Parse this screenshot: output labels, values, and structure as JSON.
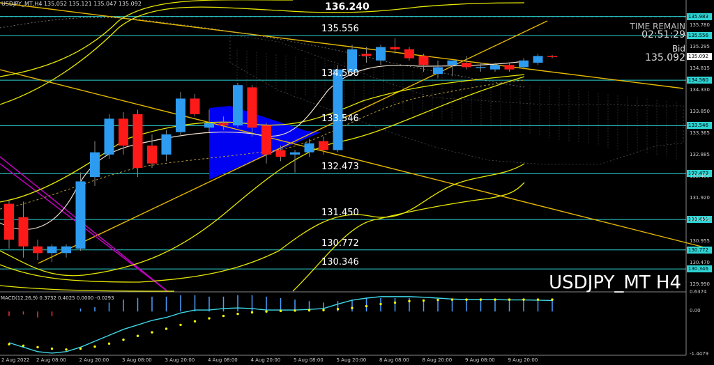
{
  "window": {
    "symbol_line": "USDJPY_MT,H4  135.052 135.121 135.047 135.092",
    "watermark": "USDJPY_MT H4"
  },
  "info": {
    "time_remain_label": "TIME REMAIN",
    "time_remain_value": "02:51:29",
    "bid_label": "Bid",
    "bid_value": "135.092"
  },
  "top_label": "136.240",
  "levels": [
    {
      "label": "135.983",
      "price": 135.983,
      "show_chart_label": false
    },
    {
      "label": "135.556",
      "price": 135.556,
      "show_chart_label": true
    },
    {
      "label": "134.560",
      "price": 134.56,
      "show_chart_label": true
    },
    {
      "label": "133.546",
      "price": 133.546,
      "show_chart_label": true
    },
    {
      "label": "132.473",
      "price": 132.473,
      "show_chart_label": true
    },
    {
      "label": "131.450",
      "price": 131.45,
      "show_chart_label": true
    },
    {
      "label": "130.772",
      "price": 130.772,
      "show_chart_label": true
    },
    {
      "label": "130.346",
      "price": 130.346,
      "show_chart_label": true
    }
  ],
  "price_axis": [
    "135.780",
    "135.295",
    "134.815",
    "134.330",
    "133.850",
    "133.365",
    "132.885",
    "132.400",
    "131.920",
    "131.435",
    "130.955",
    "130.470",
    "129.990"
  ],
  "current_price": "135.092",
  "time_axis": [
    "2 Aug 2022",
    "2 Aug 08:00",
    "2 Aug 20:00",
    "3 Aug 08:00",
    "3 Aug 20:00",
    "4 Aug 08:00",
    "4 Aug 20:00",
    "5 Aug 08:00",
    "5 Aug 20:00",
    "8 Aug 08:00",
    "8 Aug 20:00",
    "9 Aug 08:00",
    "9 Aug 20:00"
  ],
  "macd": {
    "label": "MACD(12,26,9) 0.3732 0.4025 0.0000 -0.0293",
    "axis": [
      "0.6374",
      "0.00",
      "-1.4479"
    ]
  },
  "colors": {
    "bull": "#2d9bf0",
    "bear": "#ff1a1a",
    "level_line": "#2ed3d3",
    "trendline": "#e6b800",
    "bands": "#e6e600",
    "macd_main": "#3fd7e8",
    "macd_signal": "#ffff00",
    "triangle": "#0000ff"
  },
  "chart_data": {
    "type": "candlestick",
    "ylim": [
      129.85,
      136.35
    ],
    "candles": [
      {
        "o": 131.8,
        "h": 131.9,
        "l": 130.8,
        "c": 131.0
      },
      {
        "o": 131.5,
        "h": 131.85,
        "l": 130.6,
        "c": 130.85
      },
      {
        "o": 130.85,
        "h": 131.0,
        "l": 130.55,
        "c": 130.7
      },
      {
        "o": 130.7,
        "h": 130.9,
        "l": 130.5,
        "c": 130.85
      },
      {
        "o": 130.7,
        "h": 130.9,
        "l": 130.6,
        "c": 130.85
      },
      {
        "o": 130.8,
        "h": 132.5,
        "l": 130.75,
        "c": 132.3
      },
      {
        "o": 132.4,
        "h": 133.2,
        "l": 132.2,
        "c": 132.95
      },
      {
        "o": 132.9,
        "h": 133.8,
        "l": 132.8,
        "c": 133.7
      },
      {
        "o": 133.7,
        "h": 133.85,
        "l": 132.9,
        "c": 133.1
      },
      {
        "o": 133.8,
        "h": 133.9,
        "l": 132.4,
        "c": 132.6
      },
      {
        "o": 133.1,
        "h": 133.35,
        "l": 132.6,
        "c": 132.7
      },
      {
        "o": 132.9,
        "h": 133.45,
        "l": 132.75,
        "c": 133.35
      },
      {
        "o": 133.4,
        "h": 134.3,
        "l": 133.3,
        "c": 134.15
      },
      {
        "o": 134.15,
        "h": 134.25,
        "l": 133.75,
        "c": 133.8
      },
      {
        "o": 133.5,
        "h": 133.9,
        "l": 133.4,
        "c": 133.6
      },
      {
        "o": 133.6,
        "h": 133.75,
        "l": 133.45,
        "c": 133.55
      },
      {
        "o": 133.55,
        "h": 134.5,
        "l": 133.5,
        "c": 134.45
      },
      {
        "o": 134.4,
        "h": 134.45,
        "l": 133.3,
        "c": 133.5
      },
      {
        "o": 133.55,
        "h": 133.6,
        "l": 132.7,
        "c": 132.9
      },
      {
        "o": 133.0,
        "h": 133.1,
        "l": 132.75,
        "c": 132.85
      },
      {
        "o": 132.9,
        "h": 133.0,
        "l": 132.5,
        "c": 132.95
      },
      {
        "o": 132.95,
        "h": 133.25,
        "l": 132.85,
        "c": 133.15
      },
      {
        "o": 133.2,
        "h": 133.3,
        "l": 132.9,
        "c": 133.0
      },
      {
        "o": 133.0,
        "h": 134.9,
        "l": 132.95,
        "c": 134.8
      },
      {
        "o": 134.75,
        "h": 135.35,
        "l": 134.7,
        "c": 135.25
      },
      {
        "o": 135.15,
        "h": 135.3,
        "l": 134.95,
        "c": 135.1
      },
      {
        "o": 135.0,
        "h": 135.35,
        "l": 134.9,
        "c": 135.3
      },
      {
        "o": 135.3,
        "h": 135.5,
        "l": 135.15,
        "c": 135.25
      },
      {
        "o": 135.25,
        "h": 135.3,
        "l": 135.0,
        "c": 135.05
      },
      {
        "o": 135.1,
        "h": 135.15,
        "l": 134.75,
        "c": 134.9
      },
      {
        "o": 134.7,
        "h": 135.0,
        "l": 134.6,
        "c": 134.85
      },
      {
        "o": 134.9,
        "h": 135.0,
        "l": 134.65,
        "c": 135.0
      },
      {
        "o": 134.95,
        "h": 135.1,
        "l": 134.8,
        "c": 134.85
      },
      {
        "o": 134.85,
        "h": 134.95,
        "l": 134.75,
        "c": 134.85
      },
      {
        "o": 134.8,
        "h": 134.95,
        "l": 134.75,
        "c": 134.9
      },
      {
        "o": 134.9,
        "h": 134.95,
        "l": 134.75,
        "c": 134.8
      },
      {
        "o": 134.85,
        "h": 135.05,
        "l": 134.8,
        "c": 135.0
      },
      {
        "o": 134.95,
        "h": 135.15,
        "l": 134.9,
        "c": 135.1
      },
      {
        "o": 135.1,
        "h": 135.12,
        "l": 135.05,
        "c": 135.09
      }
    ],
    "macd_histogram": [
      -0.15,
      -0.1,
      -0.2,
      -0.15,
      0.0,
      0.1,
      0.15,
      0.3,
      0.4,
      0.45,
      0.5,
      0.5,
      0.55,
      0.55,
      0.5,
      0.5,
      0.55,
      0.55,
      0.5,
      0.45,
      0.4,
      0.35,
      0.3,
      0.35,
      0.4,
      0.45,
      0.45,
      0.45,
      0.45,
      0.4,
      0.4,
      0.4,
      0.38,
      0.37,
      0.37,
      0.37,
      0.37,
      0.37,
      0.37
    ],
    "macd_main": [
      -1.05,
      -1.2,
      -1.35,
      -1.4,
      -1.35,
      -1.2,
      -1.0,
      -0.8,
      -0.6,
      -0.45,
      -0.3,
      -0.2,
      -0.05,
      0.05,
      0.05,
      0.1,
      0.12,
      0.1,
      0.05,
      0.05,
      0.05,
      0.07,
      0.1,
      0.25,
      0.38,
      0.45,
      0.5,
      0.5,
      0.5,
      0.48,
      0.45,
      0.42,
      0.4,
      0.4,
      0.4,
      0.39,
      0.39,
      0.38,
      0.37
    ],
    "macd_signal": [
      -1.1,
      -1.15,
      -1.2,
      -1.25,
      -1.28,
      -1.25,
      -1.18,
      -1.08,
      -0.95,
      -0.82,
      -0.7,
      -0.58,
      -0.45,
      -0.33,
      -0.23,
      -0.15,
      -0.08,
      -0.03,
      0.0,
      0.02,
      0.03,
      0.04,
      0.05,
      0.08,
      0.12,
      0.18,
      0.25,
      0.3,
      0.35,
      0.37,
      0.39,
      0.4,
      0.4,
      0.4,
      0.4,
      0.4,
      0.4,
      0.4,
      0.4
    ]
  }
}
